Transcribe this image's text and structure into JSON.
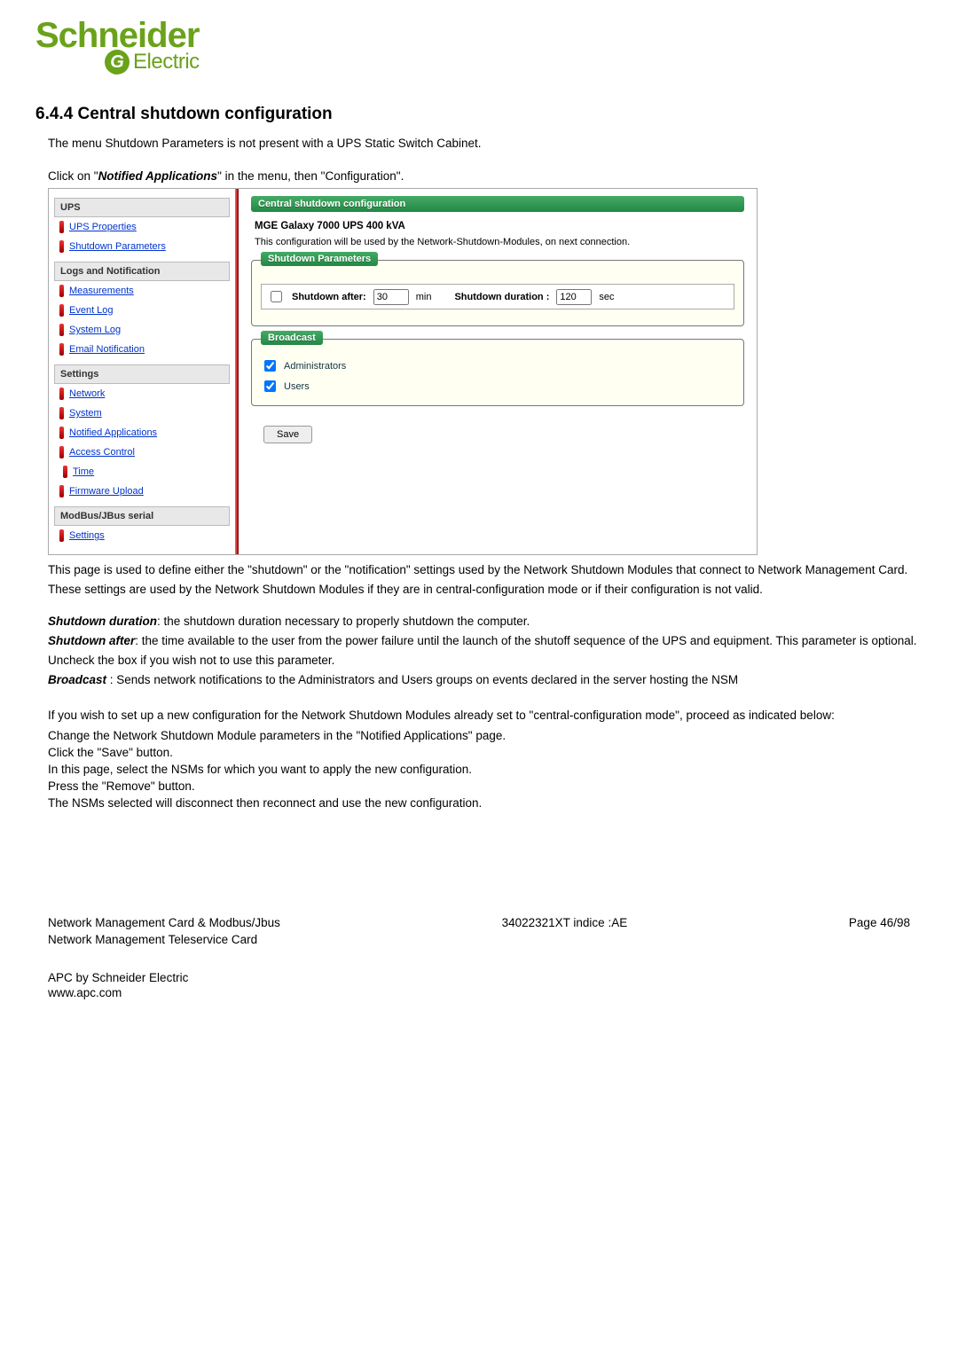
{
  "logo": {
    "main": "Schneider",
    "sub": "Electric",
    "glyph": "G"
  },
  "heading": "6.4.4   Central shutdown configuration",
  "intro": "The menu Shutdown Parameters is not present with a UPS Static Switch Cabinet.",
  "click_pre": "Click on \"",
  "click_bold": "Notified Applications",
  "click_post": "\" in the menu, then \"Configuration\".",
  "nav": {
    "ups_head": "UPS",
    "ups": [
      "UPS Properties",
      "Shutdown Parameters"
    ],
    "logs_head": "Logs and Notification",
    "logs": [
      "Measurements",
      "Event Log",
      "System Log",
      "Email Notification"
    ],
    "settings_head": "Settings",
    "settings": [
      "Network",
      "System",
      "Notified Applications",
      "Access Control",
      "Time",
      "Firmware Upload"
    ],
    "modbus_head": "ModBus/JBus serial",
    "modbus": [
      "Settings"
    ]
  },
  "main": {
    "bar": "Central shutdown configuration",
    "ups_name": "MGE Galaxy 7000 UPS 400 kVA",
    "desc": "This configuration will be used by the Network-Shutdown-Modules, on next connection.",
    "sp_legend": "Shutdown Parameters",
    "sd_after_lbl": "Shutdown after:",
    "sd_after_val": "30",
    "sd_after_unit": "min",
    "sd_dur_lbl": "Shutdown duration :",
    "sd_dur_val": "120",
    "sd_dur_unit": "sec",
    "bc_legend": "Broadcast",
    "bc_admin": "Administrators",
    "bc_users": "Users",
    "save": "Save"
  },
  "para1": "This page is used to define either the \"shutdown\" or the \"notification\" settings used by the Network Shutdown Modules that connect to Network Management Card. These settings are used by the Network Shutdown Modules if they are in central-configuration mode or if their configuration is not valid.",
  "defs": {
    "sd_dur_lbl": "Shutdown duration",
    "sd_dur_txt": ": the shutdown duration necessary to properly shutdown the computer.",
    "sd_aft_lbl": "Shutdown after",
    "sd_aft_txt": ": the time available to the user from the power failure until the launch of the shutoff sequence of the UPS and equipment. This parameter is optional. Uncheck the box if you wish not to use this parameter.",
    "bc_lbl": "Broadcast",
    "bc_txt": " : Sends network notifications to the Administrators and Users groups on events declared in the server hosting the NSM"
  },
  "howto": {
    "intro": "If you wish to set up a new configuration for the Network Shutdown Modules already set to \"central-configuration mode\", proceed as indicated below:",
    "s1": "Change the Network Shutdown Module parameters in the \"Notified Applications\" page.",
    "s2": "Click the \"Save\" button.",
    "s3": "In this page, select the NSMs for which you want to apply the new configuration.",
    "s4": "Press the \"Remove\" button.",
    "s5": "The NSMs selected will disconnect then reconnect and use the new configuration."
  },
  "footer": {
    "left1": "Network Management Card & Modbus/Jbus",
    "left2": "Network Management Teleservice Card",
    "center": "34022321XT indice :AE",
    "right": "Page 46/98",
    "co1": "APC by Schneider Electric",
    "co2": "www.apc.com"
  }
}
